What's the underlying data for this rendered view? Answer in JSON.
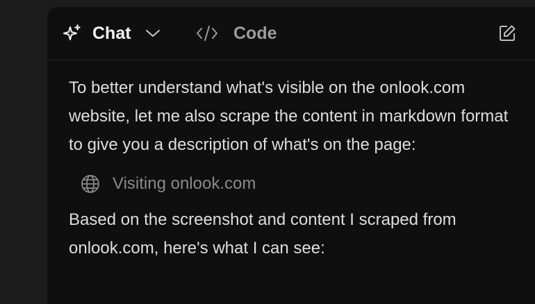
{
  "header": {
    "tabs": [
      {
        "label": "Chat",
        "icon": "sparkles-icon",
        "active": true
      },
      {
        "label": "Code",
        "icon": "code-icon",
        "active": false
      }
    ],
    "edit_icon": "edit-icon"
  },
  "messages": [
    {
      "text": "To better understand what's visible on the onlook.com website, let me also scrape the content in markdown format to give you a description of what's on the page:"
    },
    {
      "tool_call": {
        "icon": "globe-icon",
        "label": "Visiting onlook.com"
      }
    },
    {
      "text": "Based on the screenshot and content I scraped from onlook.com, here's what I can see:"
    }
  ],
  "colors": {
    "background": "#1c1c1c",
    "panel": "#0f0f0f",
    "text": "#dedede",
    "muted": "#8a8a8a",
    "inactive_tab": "#9c9c9c"
  }
}
